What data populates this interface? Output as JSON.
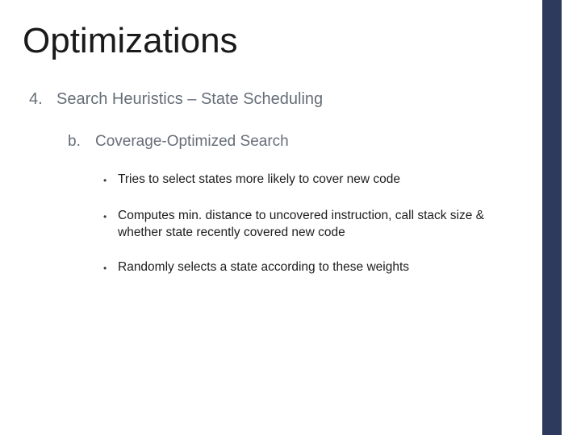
{
  "title": "Optimizations",
  "heading": {
    "marker": "4.",
    "text": "Search Heuristics – State Scheduling"
  },
  "sub": {
    "marker": "b.",
    "text": "Coverage-Optimized Search"
  },
  "bullets": [
    "Tries to select states more likely to cover new code",
    "Computes min. distance to uncovered instruction, call stack size & whether state recently covered new code",
    "Randomly selects a state according to these weights"
  ]
}
